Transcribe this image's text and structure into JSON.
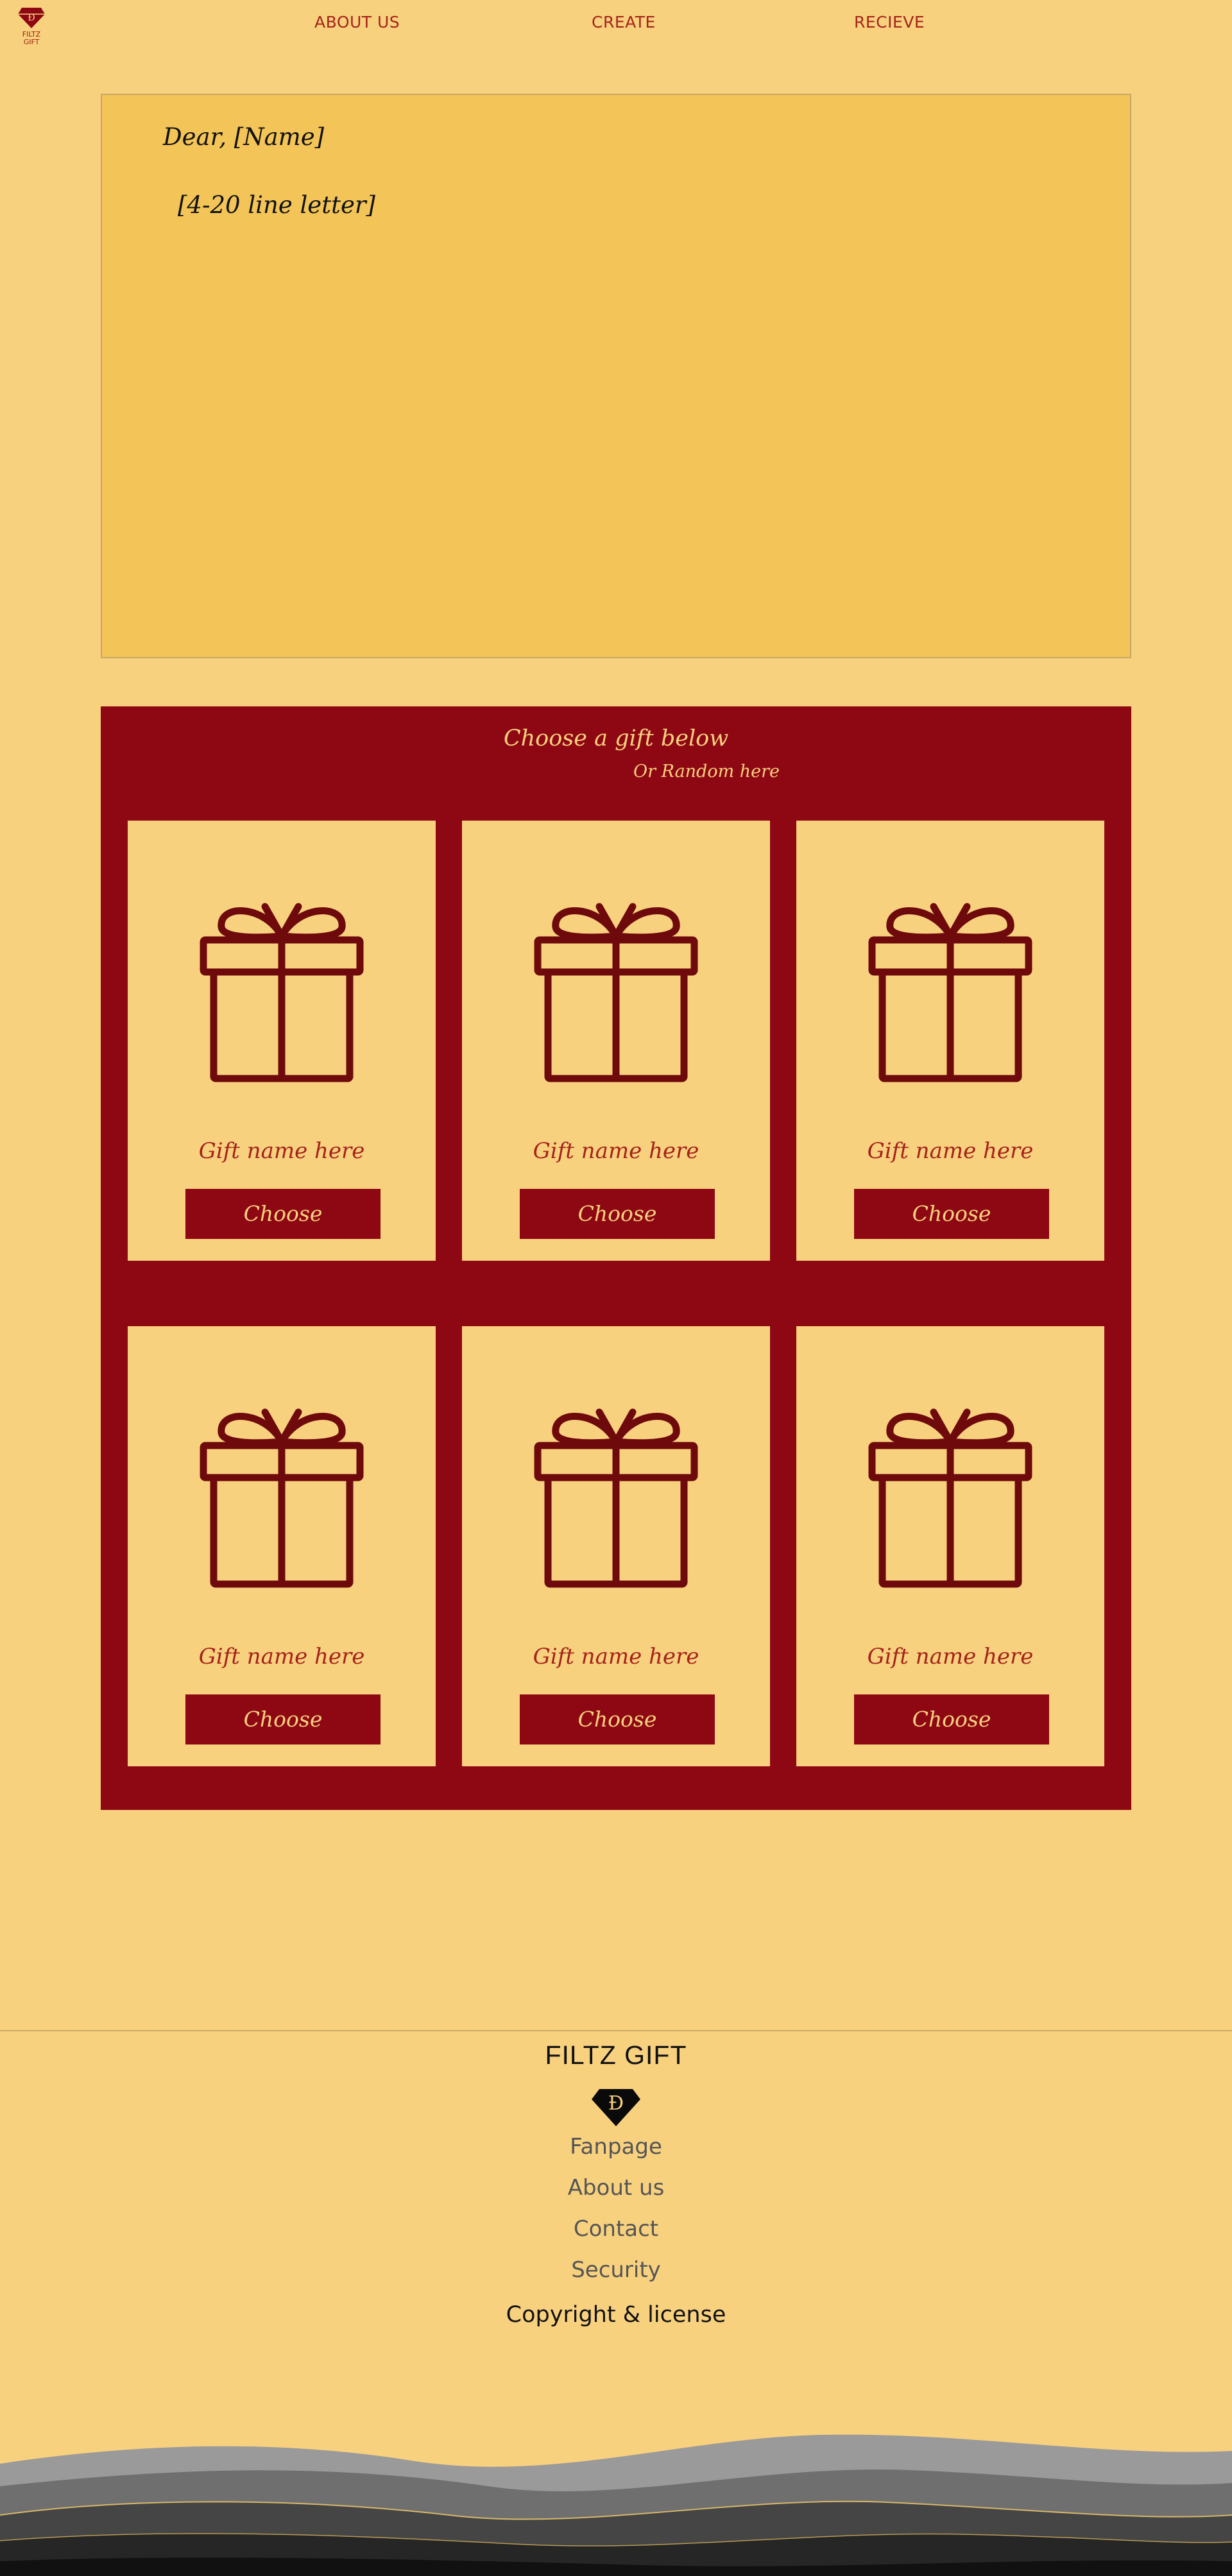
{
  "brand": {
    "logo_text": "FILTZ\nGIFT"
  },
  "nav": {
    "items": [
      {
        "label": "ABOUT US"
      },
      {
        "label": "CREATE"
      },
      {
        "label": "RECIEVE"
      }
    ]
  },
  "letter": {
    "greeting": "Dear, [Name]",
    "body": "[4-20 line letter]"
  },
  "gifts": {
    "title": "Choose a gift below",
    "random_link": "Or Random here",
    "cards": [
      {
        "name": "Gift name here",
        "button": "Choose"
      },
      {
        "name": "Gift name here",
        "button": "Choose"
      },
      {
        "name": "Gift name here",
        "button": "Choose"
      },
      {
        "name": "Gift name here",
        "button": "Choose"
      },
      {
        "name": "Gift name here",
        "button": "Choose"
      },
      {
        "name": "Gift name here",
        "button": "Choose"
      }
    ],
    "icon": "gift-box-icon"
  },
  "footer": {
    "title": "FILTZ GIFT",
    "links": [
      {
        "label": "Fanpage"
      },
      {
        "label": "About us"
      },
      {
        "label": "Contact"
      },
      {
        "label": "Security"
      }
    ],
    "copyright": "Copyright & license"
  },
  "colors": {
    "background": "#f8d17f",
    "letter_paper": "#f3c457",
    "accent_red": "#8e0814",
    "nav_text": "#a5231a"
  }
}
